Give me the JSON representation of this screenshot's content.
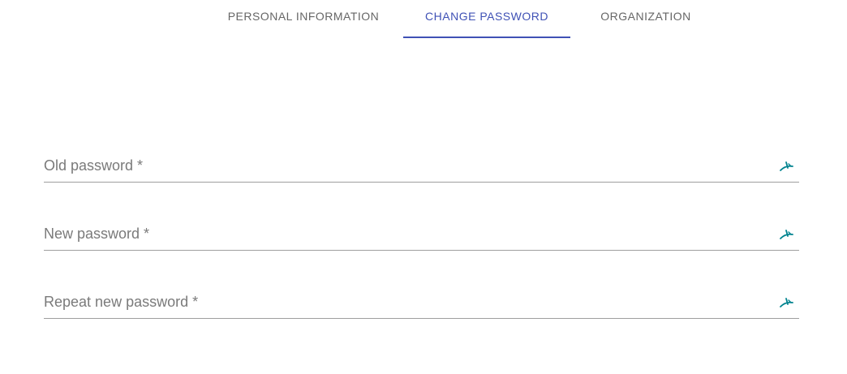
{
  "tabs": {
    "items": [
      {
        "label": "PERSONAL INFORMATION"
      },
      {
        "label": "CHANGE PASSWORD"
      },
      {
        "label": "ORGANIZATION"
      }
    ],
    "active": "CHANGE PASSWORD"
  },
  "form": {
    "fields": [
      {
        "placeholder": "Old password *",
        "value": "",
        "icon": "eye-off-icon"
      },
      {
        "placeholder": "New password *",
        "value": "",
        "icon": "eye-off-icon"
      },
      {
        "placeholder": "Repeat new password *",
        "value": "",
        "icon": "eye-off-icon"
      }
    ]
  },
  "colors": {
    "accent": "#3f51b5",
    "icon": "#00838f",
    "tab_inactive": "#666666",
    "underline": "#9e9e9e"
  }
}
